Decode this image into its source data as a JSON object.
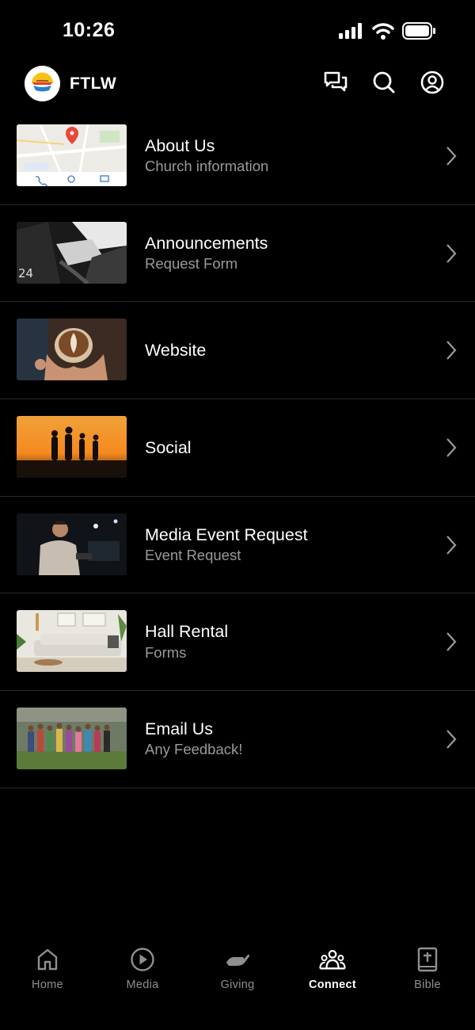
{
  "status_bar": {
    "time": "10:26",
    "icons": [
      "cellular-signal-icon",
      "wifi-icon",
      "battery-icon"
    ]
  },
  "header": {
    "title": "FTLW",
    "logo": "ftlw-logo",
    "actions": [
      {
        "name": "chat-icon"
      },
      {
        "name": "search-icon"
      },
      {
        "name": "profile-icon"
      }
    ]
  },
  "list": {
    "items": [
      {
        "title": "About Us",
        "subtitle": "Church information",
        "thumbnail": "map-thumbnail"
      },
      {
        "title": "Announcements",
        "subtitle": "Request Form",
        "thumbnail": "laptop-photo-thumbnail"
      },
      {
        "title": "Website",
        "subtitle": "",
        "thumbnail": "coffee-photo-thumbnail"
      },
      {
        "title": "Social",
        "subtitle": "",
        "thumbnail": "sunset-silhouettes-thumbnail"
      },
      {
        "title": "Media Event Request",
        "subtitle": "Event Request",
        "thumbnail": "studio-photo-thumbnail"
      },
      {
        "title": "Hall Rental",
        "subtitle": "Forms",
        "thumbnail": "living-room-thumbnail"
      },
      {
        "title": "Email Us",
        "subtitle": "Any Feedback!",
        "thumbnail": "group-photo-thumbnail"
      }
    ]
  },
  "bottom_nav": {
    "items": [
      {
        "label": "Home",
        "icon": "home-icon",
        "active": false
      },
      {
        "label": "Media",
        "icon": "play-circle-icon",
        "active": false
      },
      {
        "label": "Giving",
        "icon": "giving-hand-icon",
        "active": false
      },
      {
        "label": "Connect",
        "icon": "people-group-icon",
        "active": true
      },
      {
        "label": "Bible",
        "icon": "bible-icon",
        "active": false
      }
    ]
  },
  "colors": {
    "background": "#000000",
    "divider": "#2a2a2a",
    "subtitle": "#9a9a9a",
    "nav_inactive": "#8f8f8f",
    "nav_active": "#ffffff"
  }
}
